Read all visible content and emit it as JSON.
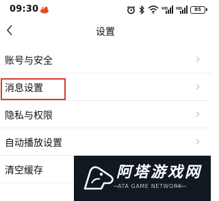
{
  "status_bar": {
    "time": "09:30",
    "battery": "85",
    "icons": [
      "app-notification-icon",
      "alarm-icon",
      "bluetooth-icon",
      "wifi-icon",
      "hd-signal-icon",
      "hd-signal-icon",
      "battery-icon"
    ]
  },
  "nav": {
    "back_icon": "chevron-left-icon",
    "title": "设置"
  },
  "settings": {
    "items": [
      {
        "label": "账号与安全"
      },
      {
        "label": "消息设置"
      },
      {
        "label": "隐私与权限"
      },
      {
        "label": "自动播放设置"
      },
      {
        "label": "清空缓存"
      }
    ]
  },
  "annotation": {
    "highlight_color": "#d43a2c"
  },
  "watermark": {
    "title": "阿塔游戏网",
    "subtitle": "ATA GAME NETWORK"
  }
}
